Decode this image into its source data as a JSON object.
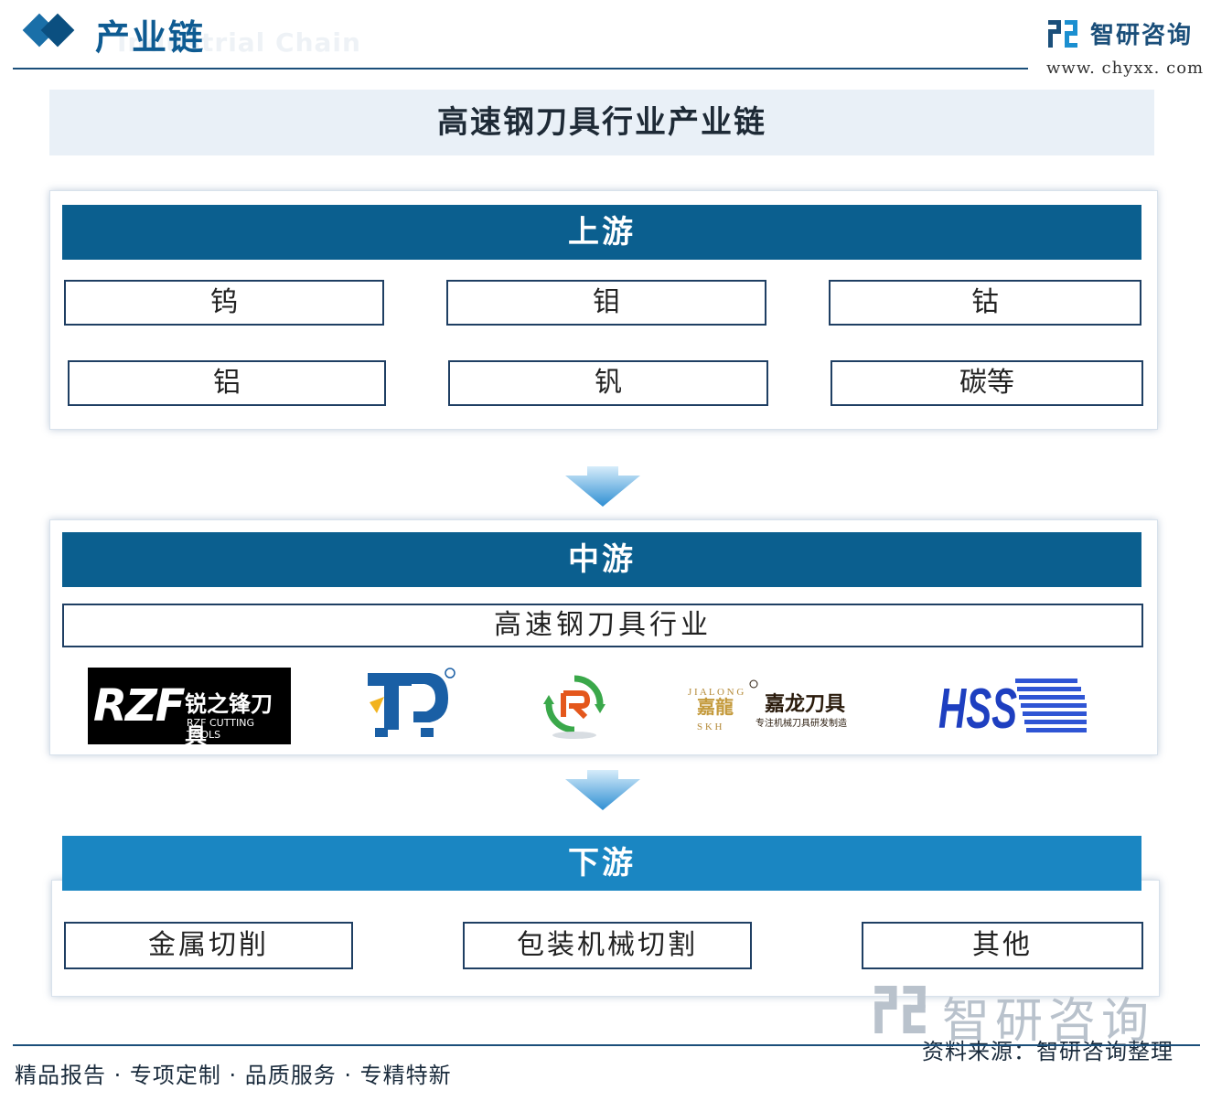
{
  "header": {
    "title": "产业链",
    "subtitle": "Industrial Chain",
    "brand_name": "智研咨询",
    "brand_url": "www. chyxx. com"
  },
  "diagram_title": "高速钢刀具行业产业链",
  "upstream": {
    "label": "上游",
    "items": [
      "钨",
      "钼",
      "钴",
      "铝",
      "钒",
      "碳等"
    ]
  },
  "midstream": {
    "label": "中游",
    "industry": "高速钢刀具行业",
    "logos": [
      {
        "icon": "rzf-logo",
        "text": "RZF",
        "text_cn": "锐之锋刀具",
        "text_en": "RZF CUTTING TOOLS"
      },
      {
        "icon": "jindong-logo"
      },
      {
        "icon": "recycle-arrows-logo"
      },
      {
        "icon": "jialong-logo",
        "text": "嘉龙刀具",
        "text_sub": "专注机械刀具研发制造"
      },
      {
        "icon": "hss-logo",
        "text": "HSS"
      }
    ]
  },
  "downstream": {
    "label": "下游",
    "items": [
      "金属切削",
      "包装机械切割",
      "其他"
    ]
  },
  "footer": {
    "slogan": "精品报告 · 专项定制 · 品质服务 · 专精特新",
    "source": "资料来源：智研咨询整理",
    "watermark": "智研咨询"
  },
  "colors": {
    "band_dark": "#0b5f8f",
    "band_light": "#1a86c2",
    "title_band": "#e9f0f7",
    "brand_blue": "#1b4f7a",
    "arrow_blue": "#2f8fd3"
  }
}
